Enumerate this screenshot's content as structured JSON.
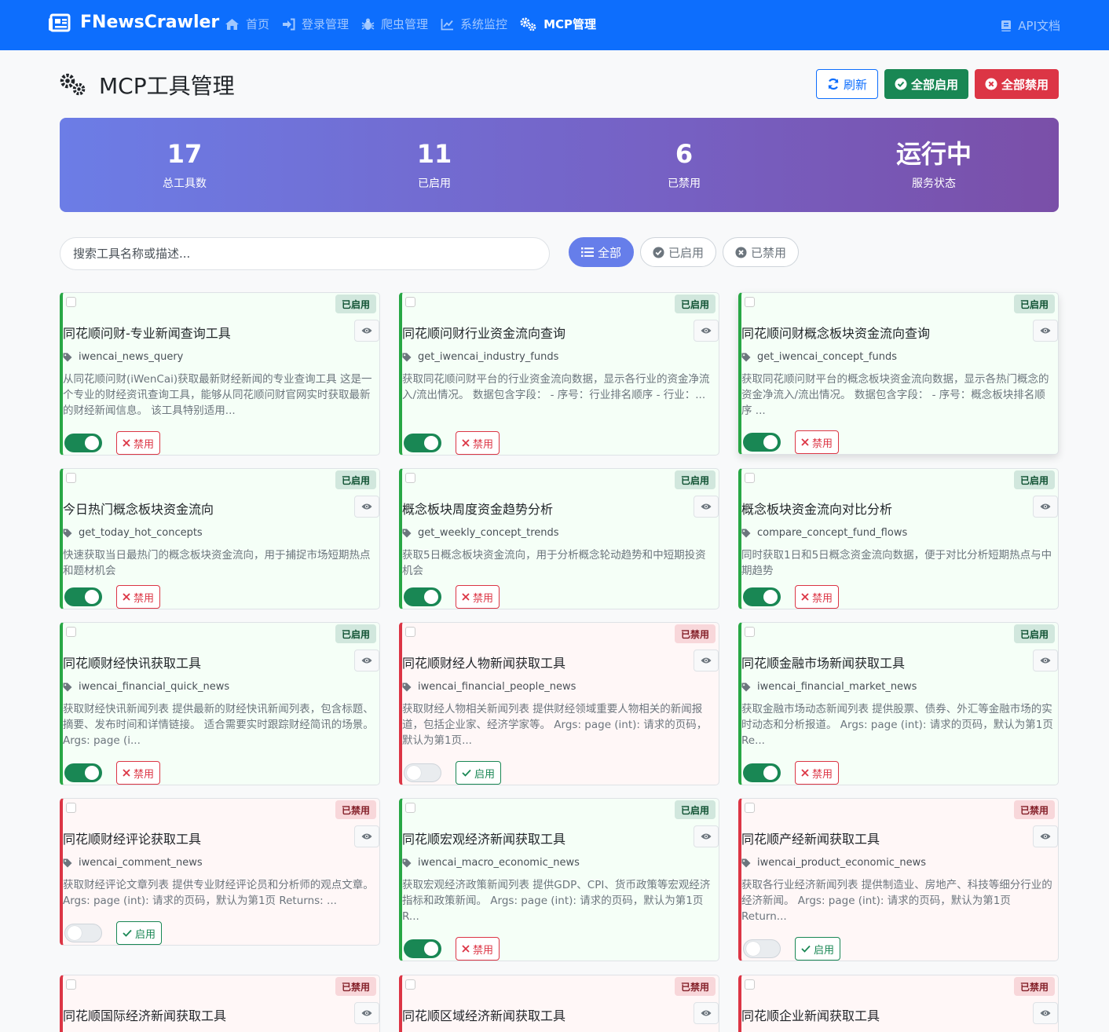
{
  "nav": {
    "brand": "FNewsCrawler",
    "links": [
      "首页",
      "登录管理",
      "爬虫管理",
      "系统监控",
      "MCP管理"
    ],
    "api_docs": "API文档"
  },
  "header": {
    "title": "MCP工具管理",
    "refresh": "刷新",
    "enable_all": "全部启用",
    "disable_all": "全部禁用"
  },
  "stats": [
    {
      "value": "17",
      "label": "总工具数"
    },
    {
      "value": "11",
      "label": "已启用"
    },
    {
      "value": "6",
      "label": "已禁用"
    },
    {
      "value": "运行中",
      "label": "服务状态"
    }
  ],
  "search": {
    "placeholder": "搜索工具名称或描述..."
  },
  "filters": [
    "全部",
    "已启用",
    "已禁用"
  ],
  "labels": {
    "enabled": "已启用",
    "disabled": "已禁用",
    "btn_disable": "禁用",
    "btn_enable": "启用"
  },
  "tools": [
    {
      "title": "同花顺问财-专业新闻查询工具",
      "fn": "iwencai_news_query",
      "desc": "从同花顺问财(iWenCai)获取最新财经新闻的专业查询工具 这是一个专业的财经资讯查询工具，能够从同花顺问财官网实时获取最新的财经新闻信息。 该工具特别适用...",
      "enabled": true
    },
    {
      "title": "同花顺问财行业资金流向查询",
      "fn": "get_iwencai_industry_funds",
      "desc": "获取同花顺问财平台的行业资金流向数据，显示各行业的资金净流入/流出情况。 数据包含字段： - 序号：行业排名顺序 - 行业：...",
      "enabled": true
    },
    {
      "title": "同花顺问财概念板块资金流向查询",
      "fn": "get_iwencai_concept_funds",
      "desc": "获取同花顺问财平台的概念板块资金流向数据，显示各热门概念的资金净流入/流出情况。 数据包含字段： - 序号：概念板块排名顺序 ...",
      "enabled": true
    },
    {
      "title": "今日热门概念板块资金流向",
      "fn": "get_today_hot_concepts",
      "desc": "快速获取当日最热门的概念板块资金流向，用于捕捉市场短期热点和题材机会",
      "enabled": true
    },
    {
      "title": "概念板块周度资金趋势分析",
      "fn": "get_weekly_concept_trends",
      "desc": "获取5日概念板块资金流向，用于分析概念轮动趋势和中短期投资机会",
      "enabled": true
    },
    {
      "title": "概念板块资金流向对比分析",
      "fn": "compare_concept_fund_flows",
      "desc": "同时获取1日和5日概念资金流向数据，便于对比分析短期热点与中期趋势",
      "enabled": true
    },
    {
      "title": "同花顺财经快讯获取工具",
      "fn": "iwencai_financial_quick_news",
      "desc": "获取财经快讯新闻列表 提供最新的财经快讯新闻列表，包含标题、摘要、发布时间和详情链接。 适合需要实时跟踪财经简讯的场景。 Args: page (i...",
      "enabled": true
    },
    {
      "title": "同花顺财经人物新闻获取工具",
      "fn": "iwencai_financial_people_news",
      "desc": "获取财经人物相关新闻列表 提供财经领域重要人物相关的新闻报道，包括企业家、经济学家等。 Args: page (int): 请求的页码，默认为第1页...",
      "enabled": false
    },
    {
      "title": "同花顺金融市场新闻获取工具",
      "fn": "iwencai_financial_market_news",
      "desc": "获取金融市场动态新闻列表 提供股票、债券、外汇等金融市场的实时动态和分析报道。 Args: page (int): 请求的页码，默认为第1页 Re...",
      "enabled": true
    },
    {
      "title": "同花顺财经评论获取工具",
      "fn": "iwencai_comment_news",
      "desc": "获取财经评论文章列表 提供专业财经评论员和分析师的观点文章。 Args: page (int): 请求的页码，默认为第1页 Returns: ...",
      "enabled": false
    },
    {
      "title": "同花顺宏观经济新闻获取工具",
      "fn": "iwencai_macro_economic_news",
      "desc": "获取宏观经济政策新闻列表 提供GDP、CPI、货币政策等宏观经济指标和政策新闻。 Args: page (int): 请求的页码，默认为第1页 R...",
      "enabled": true
    },
    {
      "title": "同花顺产经新闻获取工具",
      "fn": "iwencai_product_economic_news",
      "desc": "获取各行业经济新闻列表 提供制造业、房地产、科技等细分行业的经济新闻。 Args: page (int): 请求的页码，默认为第1页 Return...",
      "enabled": false
    },
    {
      "title": "同花顺国际经济新闻获取工具",
      "fn": "",
      "desc": "",
      "enabled": false
    },
    {
      "title": "同花顺区域经济新闻获取工具",
      "fn": "",
      "desc": "",
      "enabled": false
    },
    {
      "title": "同花顺企业新闻获取工具",
      "fn": "",
      "desc": "",
      "enabled": false
    }
  ]
}
